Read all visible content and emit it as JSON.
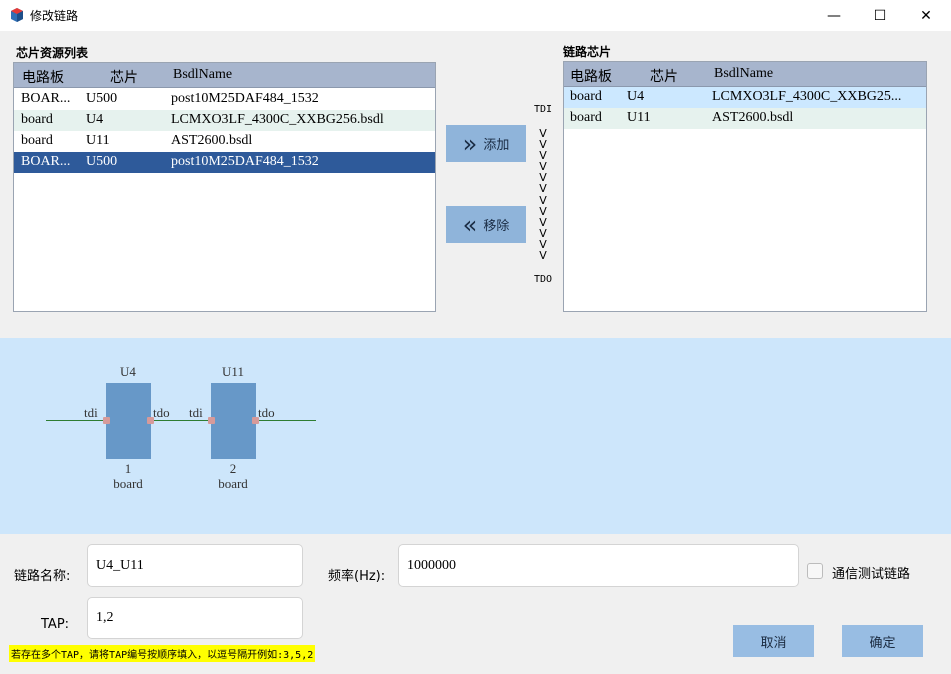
{
  "window": {
    "title": "修改链路",
    "minimize": "—",
    "maximize": "☐",
    "close": "✕"
  },
  "left_table": {
    "label": "芯片资源列表",
    "headers": [
      "电路板",
      "芯片",
      "BsdlName"
    ],
    "rows": [
      [
        "BOAR...",
        "U500",
        "post10M25DAF484_1532"
      ],
      [
        "board",
        "U4",
        "LCMXO3LF_4300C_XXBG256.bsdl"
      ],
      [
        "board",
        "U11",
        "AST2600.bsdl"
      ],
      [
        "BOAR...",
        "U500",
        "post10M25DAF484_1532"
      ]
    ],
    "selected_row": 3
  },
  "right_table": {
    "label": "链路芯片",
    "headers": [
      "电路板",
      "芯片",
      "BsdlName"
    ],
    "rows": [
      [
        "board",
        "U4",
        "LCMXO3LF_4300C_XXBG25..."
      ],
      [
        "board",
        "U11",
        "AST2600.bsdl"
      ]
    ],
    "selected_row": 0
  },
  "buttons": {
    "add_label": "添加",
    "add_icon": "»",
    "remove_label": "移除",
    "remove_icon": "«",
    "cancel_label": "取消",
    "ok_label": "确定"
  },
  "chain_arrows": {
    "tdi": "TDI",
    "tdo": "TDO",
    "arrows": [
      "V",
      "V",
      "V",
      "V",
      "V",
      "V",
      "V",
      "V",
      "V",
      "V",
      "V",
      "V"
    ]
  },
  "chain_diagram": {
    "chips": [
      {
        "name": "U4",
        "index": "1",
        "board": "board",
        "tdi": "tdi",
        "tdo": "tdo"
      },
      {
        "name": "U11",
        "index": "2",
        "board": "board",
        "tdi": "tdi",
        "tdo": "tdo"
      }
    ],
    "colors": {
      "chip": "#6798c8",
      "panel": "#cde6fb",
      "wire": "#2e7d32",
      "pin": "#d69a9a"
    }
  },
  "form": {
    "chain_name_label": "链路名称:",
    "chain_name_value": "U4_U11",
    "freq_label": "频率(Hz):",
    "freq_value": "1000000",
    "comm_test_label": "通信测试链路",
    "comm_test_checked": false,
    "tap_label": "TAP:",
    "tap_value": "1,2",
    "hint": "若存在多个TAP，请将TAP编号按顺序填入，以逗号隔开例如:3,5,2"
  }
}
